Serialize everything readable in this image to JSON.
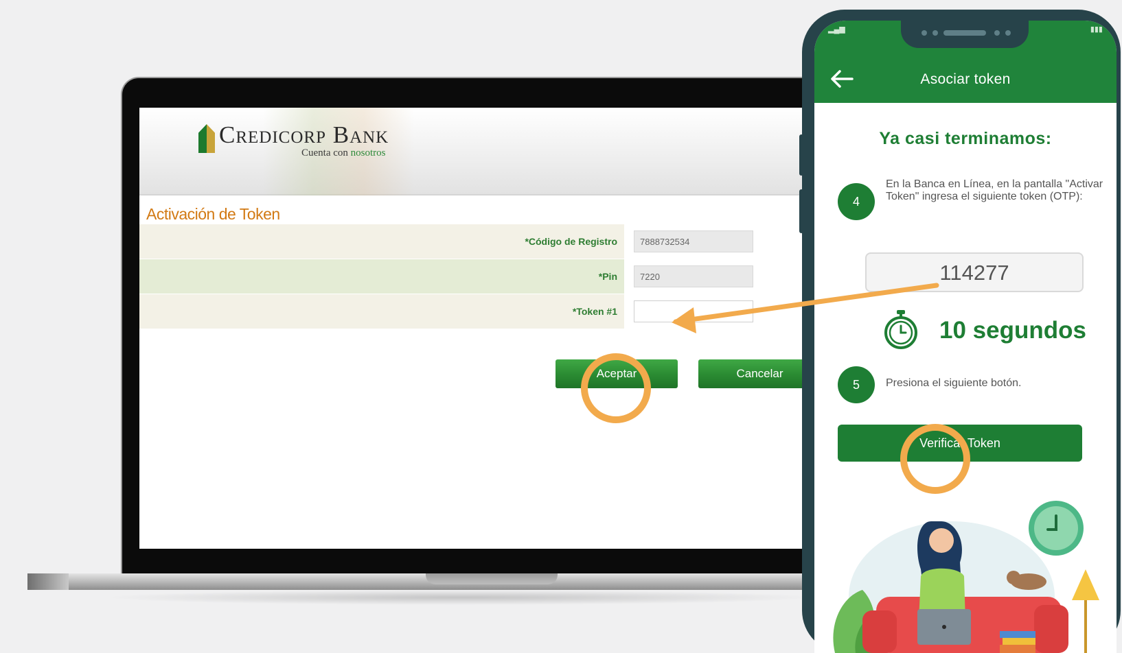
{
  "laptop": {
    "bank": {
      "name": "Credicorp Bank",
      "tagline_prefix": "Cuenta con ",
      "tagline_highlight": "nosotros"
    },
    "form": {
      "title": "Activación de Token",
      "fields": [
        {
          "label": "*Código de Registro",
          "value": "7888732534"
        },
        {
          "label": "*Pin",
          "value": "7220"
        },
        {
          "label": "*Token #1",
          "value": ""
        }
      ],
      "accept_label": "Aceptar",
      "cancel_label": "Cancelar"
    }
  },
  "phone": {
    "appbar_title": "Asociar token",
    "heading": "Ya casi terminamos:",
    "steps": [
      {
        "number": "4",
        "text": "En la Banca en Línea, en la pantalla \"Activar Token\" ingresa el siguiente token (OTP):"
      },
      {
        "number": "5",
        "text": "Presiona el siguiente botón."
      }
    ],
    "otp": "114277",
    "timer": "10 segundos",
    "verify_label": "Verificar Token"
  },
  "colors": {
    "brand_green": "#1e7e34",
    "accent_orange": "#f2aa4c",
    "title_orange": "#d27a14"
  },
  "icons": [
    "back-arrow-icon",
    "stopwatch-icon",
    "logo-icon"
  ]
}
